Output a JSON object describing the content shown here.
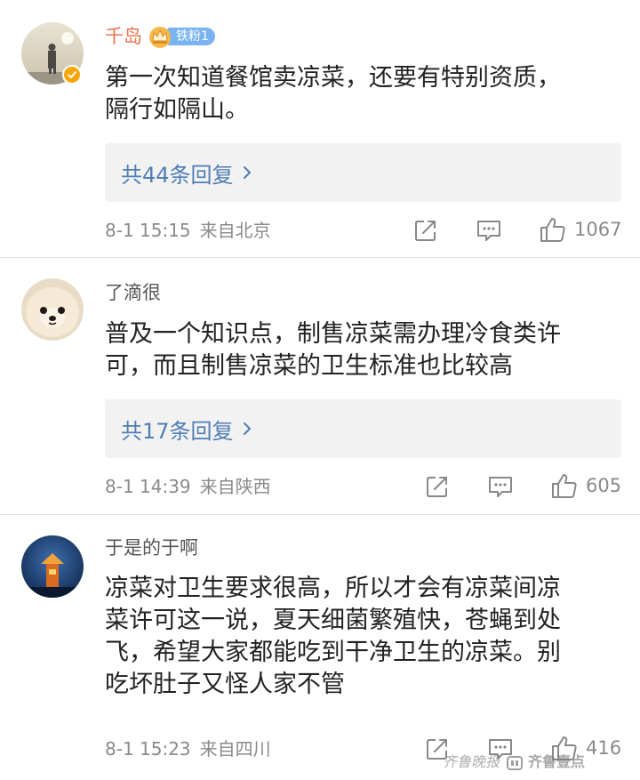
{
  "comments": [
    {
      "username": "千岛",
      "fan_badge": "铁粉1",
      "text_lines": [
        "第一次知道餐馆卖凉菜，还要有特别资质，",
        "隔行如隔山。"
      ],
      "reply_label": "共44条回复",
      "date": "8-1 15:15",
      "location": "来自北京",
      "likes": "1067"
    },
    {
      "username": "了滴很",
      "text_lines": [
        "普及一个知识点，制售凉菜需办理冷食类许",
        "可，而且制售凉菜的卫生标准也比较高"
      ],
      "reply_label": "共17条回复",
      "date": "8-1 14:39",
      "location": "来自陕西",
      "likes": "605"
    },
    {
      "username": "于是的于啊",
      "text_lines": [
        "凉菜对卫生要求很高，所以才会有凉菜间凉",
        "菜许可这一说，夏天细菌繁殖快，苍蝇到处",
        "飞，希望大家都能吃到干净卫生的凉菜。别",
        "吃坏肚子又怪人家不管"
      ],
      "date": "8-1 15:23",
      "location": "来自四川",
      "likes": "416"
    }
  ],
  "icons": {
    "share": "share-icon",
    "comment": "comment-icon",
    "like": "thumbs-up-icon",
    "reply_arrow": "chevron-right-icon",
    "crown": "crown-icon",
    "verify": "verified-badge-icon"
  },
  "colors": {
    "vip_name": "#eb7350",
    "reply_link": "#4f7db5",
    "fan_badge": "#79b4f0",
    "meta_text": "#8a8a8a"
  },
  "watermark": {
    "left": "齐鲁晚报",
    "right": "齐鲁壹点"
  }
}
